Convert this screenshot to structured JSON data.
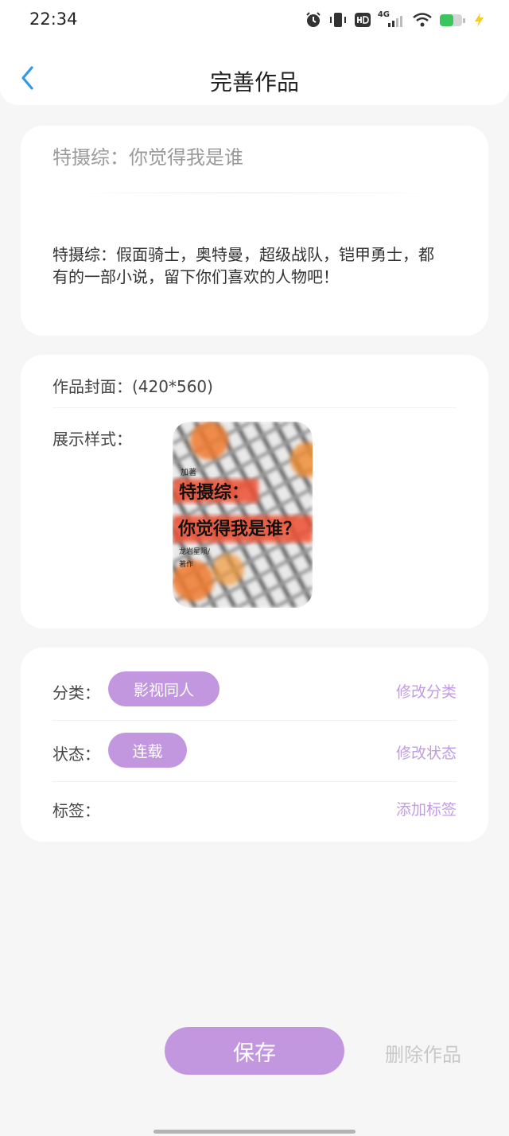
{
  "status_bar": {
    "time": "22:34",
    "network": "4G"
  },
  "header": {
    "title": "完善作品",
    "back_icon": "chevron-left-icon"
  },
  "info": {
    "work_title": "特摄综：你觉得我是谁",
    "description": "特摄综：假面骑士，奥特曼，超级战队，铠甲勇士，都有的一部小说，留下你们喜欢的人物吧！"
  },
  "cover_section": {
    "cover_label": "作品封面：(420*560)",
    "style_label": "展示样式：",
    "cover_image": {
      "top_text": "加著",
      "title_line1": "特摄综：",
      "title_line2": "你觉得我是谁？",
      "author": "龙岩星陨/",
      "author_suffix": "著作"
    }
  },
  "meta": {
    "category_label": "分类：",
    "category_value": "影视同人",
    "category_action": "修改分类",
    "status_label": "状态：",
    "status_value": "连载",
    "status_action": "修改状态",
    "tags_label": "标签：",
    "tags_action": "添加标签"
  },
  "footer": {
    "save_label": "保存",
    "delete_label": "删除作品"
  },
  "colors": {
    "accent": "#c397e0",
    "action_text": "#c29ce0",
    "back_blue": "#2f9be8",
    "background": "#f6f6f6"
  }
}
